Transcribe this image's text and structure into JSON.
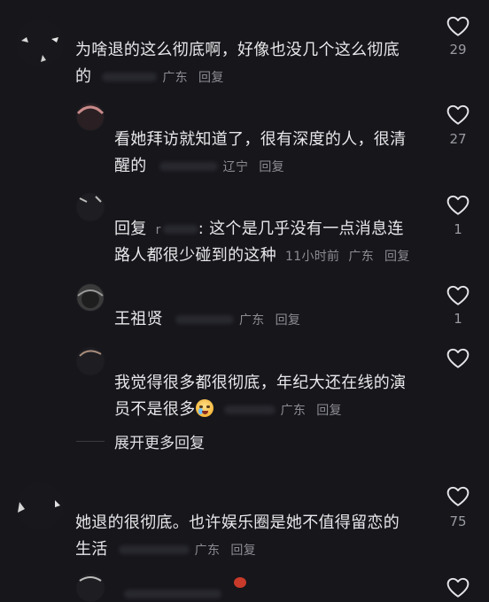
{
  "comments": [
    {
      "text1": "为啥退的这么彻底啊，好像也没几个这么彻底",
      "text2": "的",
      "location": "广东",
      "reply": "回复",
      "likes": "29"
    },
    {
      "text1": "看她拜访就知道了，很有深度的人，很清",
      "text2": "醒的",
      "location": "辽宁",
      "reply": "回复",
      "likes": "27"
    },
    {
      "text1_prefix": "回复",
      "text1_user": "r",
      "text1": ": 这个是几乎没有一点消息连",
      "text2": "路人都很少碰到的这种",
      "time": "11小时前",
      "location": "广东",
      "reply": "回复",
      "likes": "1"
    },
    {
      "text1": "王祖贤",
      "location": "广东",
      "reply": "回复",
      "likes": "1"
    },
    {
      "text1": "我觉得很多都很彻底，年纪大还在线的演",
      "text2": "员不是很多",
      "location": "广东",
      "reply": "回复",
      "emoji": "crying-laughing-emoji"
    },
    {
      "text1": "她退的很彻底。也许娱乐圈是她不值得留恋的",
      "text2": "生活",
      "location": "广东",
      "reply": "回复",
      "likes": "75"
    }
  ],
  "expand_label": "展开更多回复",
  "colors": {
    "background": "#16161b",
    "text": "#e8e8ea",
    "meta": "#8c8c93"
  }
}
